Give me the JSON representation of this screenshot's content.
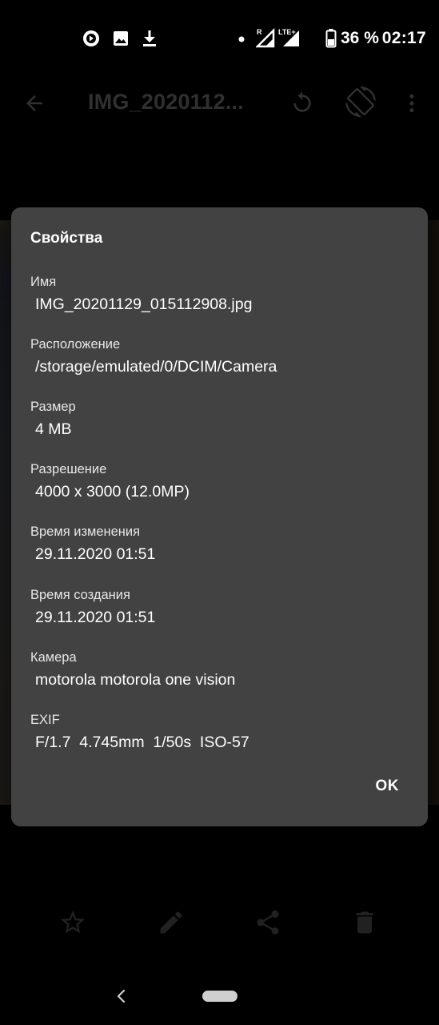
{
  "status_bar": {
    "battery_percent": "36 %",
    "time": "02:17",
    "network": "LTE+",
    "icons": [
      "playstore-icon",
      "image-icon",
      "download-icon",
      "dot-icon",
      "signal-roaming-icon",
      "signal-lte-icon",
      "battery-icon"
    ]
  },
  "app_bar": {
    "title": "IMG_2020112...",
    "icons": [
      "back-arrow-icon",
      "rotate-icon",
      "screen-rotation-icon",
      "more-vert-icon"
    ]
  },
  "dialog": {
    "title": "Свойства",
    "properties": [
      {
        "label": "Имя",
        "value": "IMG_20201129_015112908.jpg"
      },
      {
        "label": "Расположение",
        "value": "/storage/emulated/0/DCIM/Camera"
      },
      {
        "label": "Размер",
        "value": "4 MB"
      },
      {
        "label": "Разрешение",
        "value": "4000 x 3000 (12.0MP)"
      },
      {
        "label": "Время изменения",
        "value": "29.11.2020 01:51"
      },
      {
        "label": "Время создания",
        "value": "29.11.2020 01:51"
      },
      {
        "label": "Камера",
        "value": "motorola motorola one vision"
      },
      {
        "label": "EXIF",
        "value": "F/1.7  4.745mm  1/50s  ISO-57"
      }
    ],
    "ok_label": "OK"
  },
  "bottom_bar": {
    "icons": [
      "star-icon",
      "edit-icon",
      "share-icon",
      "delete-icon"
    ]
  },
  "colors": {
    "dialog_bg": "#424242",
    "dimmed_icon": "#6b6b6b"
  }
}
